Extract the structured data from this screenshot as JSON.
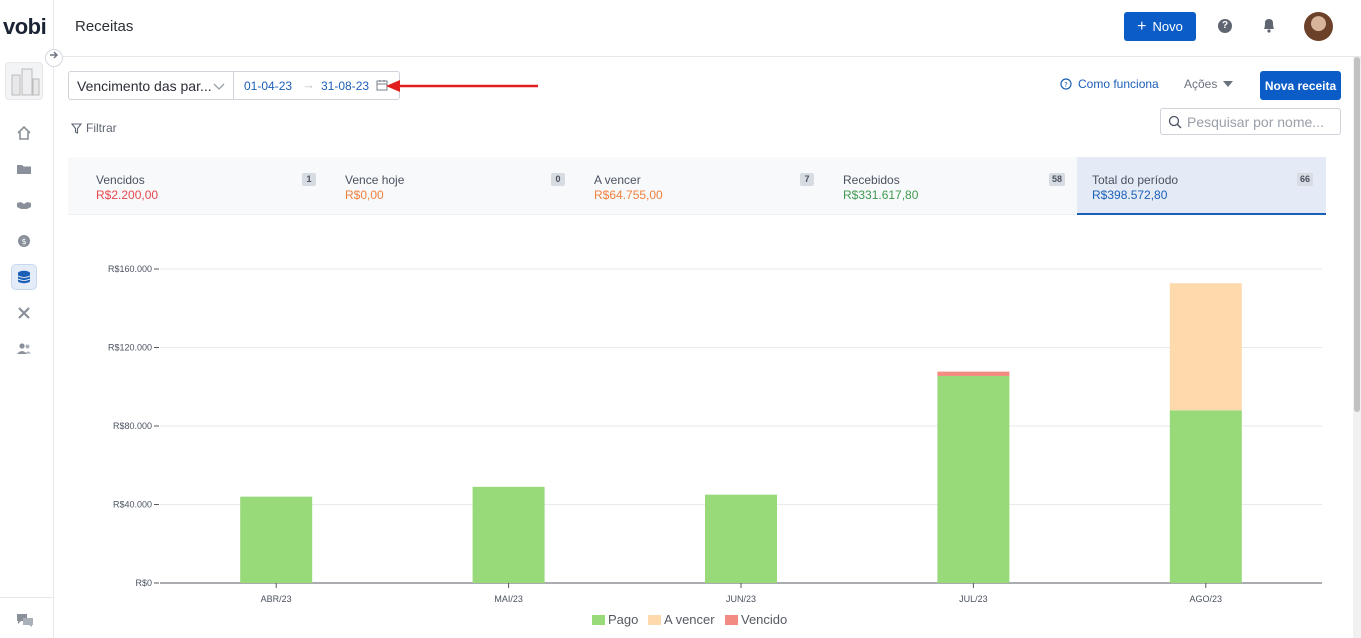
{
  "app": {
    "logo": "vobi",
    "page_title": "Receitas"
  },
  "header": {
    "new_button_label": "Novo",
    "new_button_plus": "+",
    "help_glyph": "?"
  },
  "sidebar": {
    "collapse_icon": "arrow-right-icon",
    "items": [
      {
        "icon": "home-icon",
        "active": false
      },
      {
        "icon": "folder-icon",
        "active": false
      },
      {
        "icon": "handshake-icon",
        "active": false
      },
      {
        "icon": "dollar-badge-icon",
        "active": false
      },
      {
        "icon": "coins-stack-icon",
        "active": true
      },
      {
        "icon": "tools-icon",
        "active": false
      },
      {
        "icon": "users-icon",
        "active": false
      }
    ],
    "bottom_icon": "chat-icon"
  },
  "filters": {
    "date_type": "Vencimento das par...",
    "date_start": "01-04-23",
    "date_end": "31-08-23",
    "filter_label": "Filtrar",
    "how_it_works": "Como funciona",
    "actions": "Ações",
    "new_revenue": "Nova receita",
    "search_placeholder": "Pesquisar por nome..."
  },
  "summary": [
    {
      "label": "Vencidos",
      "amount": "R$2.200,00",
      "count": "1",
      "color": "#e5484d"
    },
    {
      "label": "Vence hoje",
      "amount": "R$0,00",
      "count": "0",
      "color": "#f0803c"
    },
    {
      "label": "A vencer",
      "amount": "R$64.755,00",
      "count": "7",
      "color": "#f0803c"
    },
    {
      "label": "Recebidos",
      "amount": "R$331.617,80",
      "count": "58",
      "color": "#3f9a4f"
    },
    {
      "label": "Total do período",
      "amount": "R$398.572,80",
      "count": "66",
      "color": "#1c5fb7"
    }
  ],
  "chart_data": {
    "type": "bar",
    "stacked": true,
    "categories": [
      "ABR/23",
      "MAI/23",
      "JUN/23",
      "JUL/23",
      "AGO/23"
    ],
    "series": [
      {
        "name": "Pago",
        "color": "#98d97a",
        "values": [
          44000,
          49000,
          45000,
          105500,
          88000
        ]
      },
      {
        "name": "A vencer",
        "color": "#fdd9ac",
        "values": [
          0,
          0,
          0,
          0,
          64755
        ]
      },
      {
        "name": "Vencido",
        "color": "#f28b82",
        "values": [
          0,
          0,
          0,
          2200,
          0
        ]
      }
    ],
    "yticks": [
      {
        "value": 0,
        "label": "R$0"
      },
      {
        "value": 40000,
        "label": "R$40.000"
      },
      {
        "value": 80000,
        "label": "R$80.000"
      },
      {
        "value": 120000,
        "label": "R$120.000"
      },
      {
        "value": 160000,
        "label": "R$160.000"
      }
    ],
    "ylim": [
      0,
      160000
    ],
    "grid": true,
    "legend": "bottom-center"
  }
}
